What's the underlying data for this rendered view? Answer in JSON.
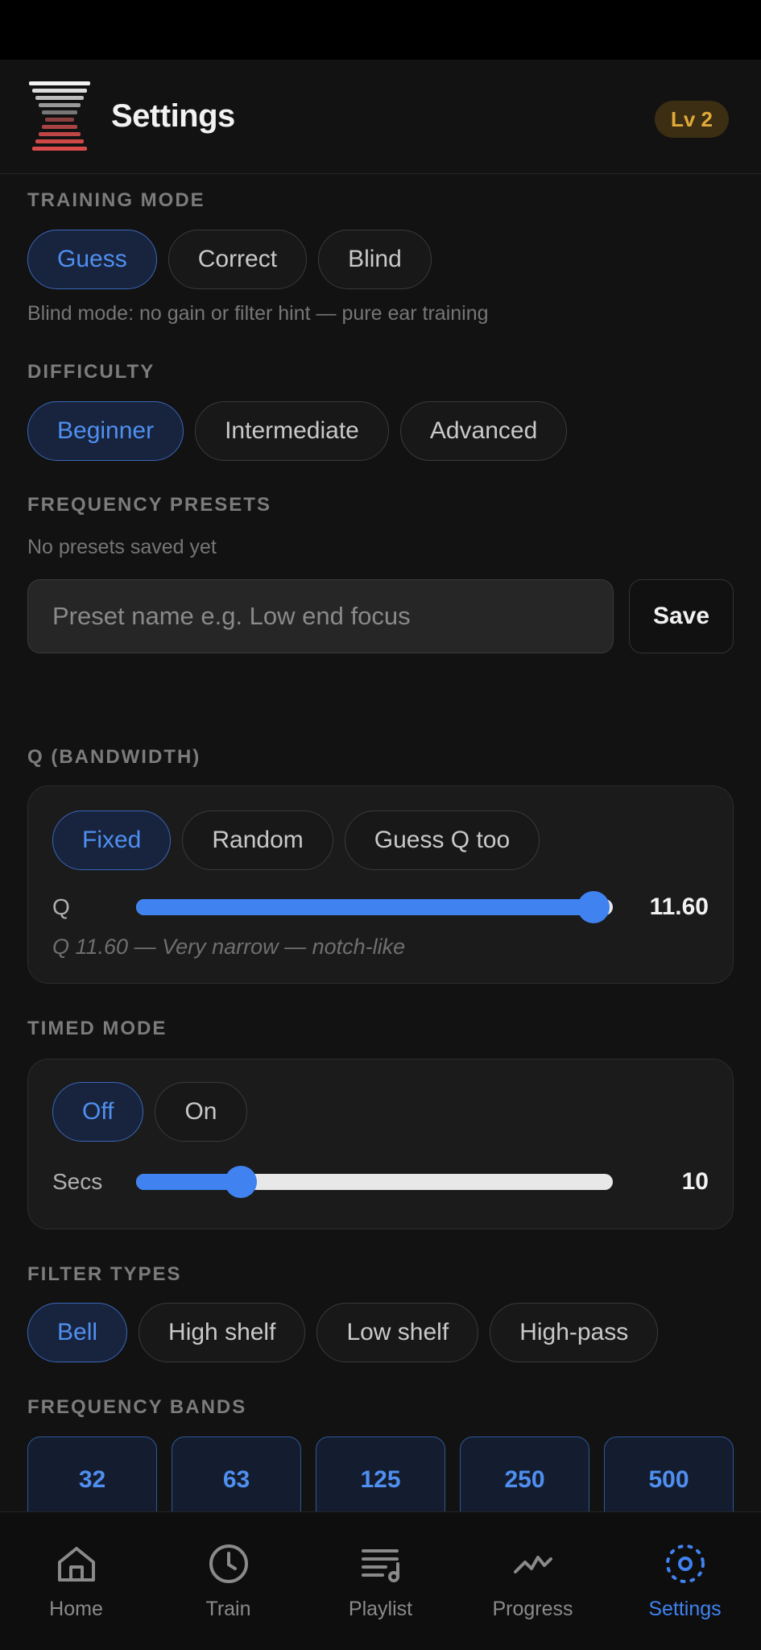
{
  "header": {
    "title": "Settings",
    "level_badge": "Lv 2"
  },
  "training_mode": {
    "label": "TRAINING MODE",
    "options": [
      "Guess",
      "Correct",
      "Blind"
    ],
    "selected": "Guess",
    "hint": "Blind mode: no gain or filter hint — pure ear training"
  },
  "difficulty": {
    "label": "DIFFICULTY",
    "options": [
      "Beginner",
      "Intermediate",
      "Advanced"
    ],
    "selected": "Beginner"
  },
  "presets": {
    "label": "FREQUENCY PRESETS",
    "empty_text": "No presets saved yet",
    "input_placeholder": "Preset name e.g. Low end focus",
    "save_label": "Save"
  },
  "q_bandwidth": {
    "label": "Q (BANDWIDTH)",
    "options": [
      "Fixed",
      "Random",
      "Guess Q too"
    ],
    "selected": "Fixed",
    "slider_label": "Q",
    "slider_value": "11.60",
    "slider_fraction": 0.96,
    "description": "Q 11.60 — Very narrow — notch-like"
  },
  "timed_mode": {
    "label": "TIMED MODE",
    "options": [
      "Off",
      "On"
    ],
    "selected": "Off",
    "slider_label": "Secs",
    "slider_value": "10",
    "slider_fraction": 0.22
  },
  "filter_types": {
    "label": "FILTER TYPES",
    "options": [
      "Bell",
      "High shelf",
      "Low shelf",
      "High-pass"
    ],
    "selected": "Bell"
  },
  "frequency_bands": {
    "label": "FREQUENCY BANDS",
    "bands": [
      "32",
      "63",
      "125",
      "250",
      "500"
    ]
  },
  "nav": {
    "items": [
      {
        "label": "Home",
        "icon": "home-icon"
      },
      {
        "label": "Train",
        "icon": "clock-icon"
      },
      {
        "label": "Playlist",
        "icon": "playlist-icon"
      },
      {
        "label": "Progress",
        "icon": "trend-icon"
      },
      {
        "label": "Settings",
        "icon": "gear-icon"
      }
    ],
    "active": "Settings"
  },
  "colors": {
    "accent": "#3f82f0",
    "badge": "#e0a93a",
    "background": "#121212"
  }
}
